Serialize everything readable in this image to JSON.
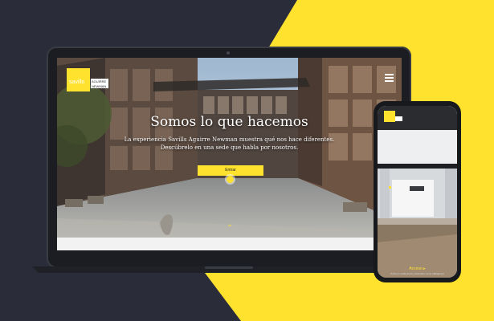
{
  "hero": {
    "title": "Somos lo que hacemos",
    "subtitle_line1": "La experiencia Savills Aguirre Newman muestra qué nos hace diferentes.",
    "subtitle_line2": "Descúbrelo en una sede que habla por nosotros.",
    "enter_label": "Entrar"
  },
  "brand": {
    "name": "savills",
    "sub_line1": "AGUIRRE",
    "sub_line2": "NEWMAN"
  },
  "phone": {
    "access_label": "Acceso ▸",
    "access_sub": "Pulsa en cada punto y descubre como trabajamos"
  },
  "colors": {
    "accent": "#ffe22e",
    "background": "#2a2c3a"
  },
  "icons": {
    "menu": "hamburger-icon",
    "scroll": "chevron-down-icon"
  }
}
